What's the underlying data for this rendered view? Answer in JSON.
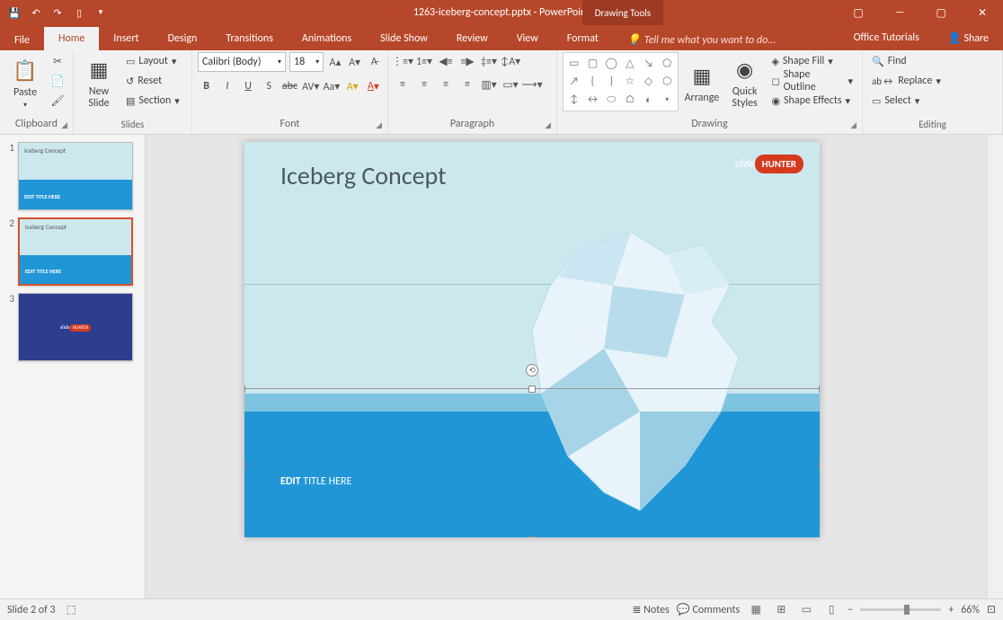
{
  "titlebar": {
    "doc": "1263-iceberg-concept.pptx - PowerPoint",
    "context_tab": "Drawing Tools"
  },
  "tabs": {
    "file": "File",
    "items": [
      "Home",
      "Insert",
      "Design",
      "Transitions",
      "Animations",
      "Slide Show",
      "Review",
      "View"
    ],
    "context": "Format",
    "tellme": "Tell me what you want to do...",
    "tutorials": "Office Tutorials",
    "share": "Share"
  },
  "ribbon": {
    "clipboard": {
      "label": "Clipboard",
      "paste": "Paste"
    },
    "slides": {
      "label": "Slides",
      "new": "New\nSlide",
      "layout": "Layout",
      "reset": "Reset",
      "section": "Section"
    },
    "font": {
      "label": "Font",
      "name": "Calibri (Body)",
      "size": "18"
    },
    "paragraph": {
      "label": "Paragraph"
    },
    "drawing": {
      "label": "Drawing",
      "arrange": "Arrange",
      "quick": "Quick\nStyles",
      "fill": "Shape Fill",
      "outline": "Shape Outline",
      "effects": "Shape Effects"
    },
    "editing": {
      "label": "Editing",
      "find": "Find",
      "replace": "Replace",
      "select": "Select"
    }
  },
  "thumbs": [
    "1",
    "2",
    "3"
  ],
  "slide": {
    "title": "Iceberg Concept",
    "logo_a": "slide",
    "logo_b": "HUNTER",
    "edit_a": "EDIT",
    "edit_b": " TITLE HERE"
  },
  "status": {
    "slide": "Slide 2 of 3",
    "lang": "",
    "notes": "Notes",
    "comments": "Comments",
    "zoom": "66%"
  }
}
